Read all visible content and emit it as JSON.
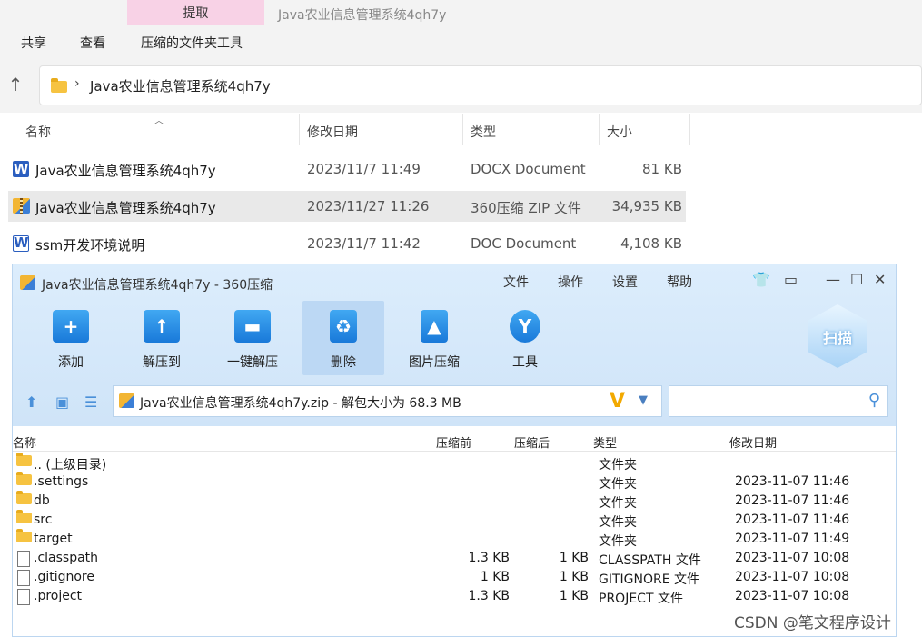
{
  "explorer": {
    "tab_extract": "提取",
    "window_title": "Java农业信息管理系统4qh7y",
    "ribbon": [
      "共享",
      "查看",
      "压缩的文件夹工具"
    ],
    "address_path": "Java农业信息管理系统4qh7y",
    "columns": {
      "name": "名称",
      "date": "修改日期",
      "type": "类型",
      "size": "大小"
    },
    "files": [
      {
        "name": "Java农业信息管理系统4qh7y",
        "date": "2023/11/7 11:49",
        "type": "DOCX Document",
        "size": "81 KB",
        "icon": "word-icon"
      },
      {
        "name": "Java农业信息管理系统4qh7y",
        "date": "2023/11/27 11:26",
        "type": "360压缩 ZIP 文件",
        "size": "34,935 KB",
        "icon": "zip-icon"
      },
      {
        "name": "ssm开发环境说明",
        "date": "2023/11/7 11:42",
        "type": "DOC Document",
        "size": "4,108 KB",
        "icon": "word-icon"
      }
    ]
  },
  "zip": {
    "title": "Java农业信息管理系统4qh7y - 360压缩",
    "menu": [
      "文件",
      "操作",
      "设置",
      "帮助"
    ],
    "toolbar": [
      "添加",
      "解压到",
      "一键解压",
      "删除",
      "图片压缩",
      "工具"
    ],
    "scan_label": "扫描",
    "path": "Java农业信息管理系统4qh7y.zip - 解包大小为 68.3 MB",
    "path_badge": "V",
    "columns": {
      "name": "名称",
      "before": "压缩前",
      "after": "压缩后",
      "type": "类型",
      "date": "修改日期"
    },
    "rows": [
      {
        "name": ".. (上级目录)",
        "before": "",
        "after": "",
        "type": "文件夹",
        "date": "",
        "icon": "folder-icon"
      },
      {
        "name": ".settings",
        "before": "",
        "after": "",
        "type": "文件夹",
        "date": "2023-11-07 11:46",
        "icon": "folder-icon"
      },
      {
        "name": "db",
        "before": "",
        "after": "",
        "type": "文件夹",
        "date": "2023-11-07 11:46",
        "icon": "folder-icon"
      },
      {
        "name": "src",
        "before": "",
        "after": "",
        "type": "文件夹",
        "date": "2023-11-07 11:46",
        "icon": "folder-icon"
      },
      {
        "name": "target",
        "before": "",
        "after": "",
        "type": "文件夹",
        "date": "2023-11-07 11:49",
        "icon": "folder-icon"
      },
      {
        "name": ".classpath",
        "before": "1.3 KB",
        "after": "1 KB",
        "type": "CLASSPATH 文件",
        "date": "2023-11-07 10:08",
        "icon": "file-icon"
      },
      {
        "name": ".gitignore",
        "before": "1 KB",
        "after": "1 KB",
        "type": "GITIGNORE 文件",
        "date": "2023-11-07 10:08",
        "icon": "file-icon"
      },
      {
        "name": ".project",
        "before": "1.3 KB",
        "after": "1 KB",
        "type": "PROJECT 文件",
        "date": "2023-11-07 10:08",
        "icon": "file-icon"
      }
    ]
  },
  "watermark": "CSDN @笔文程序设计"
}
